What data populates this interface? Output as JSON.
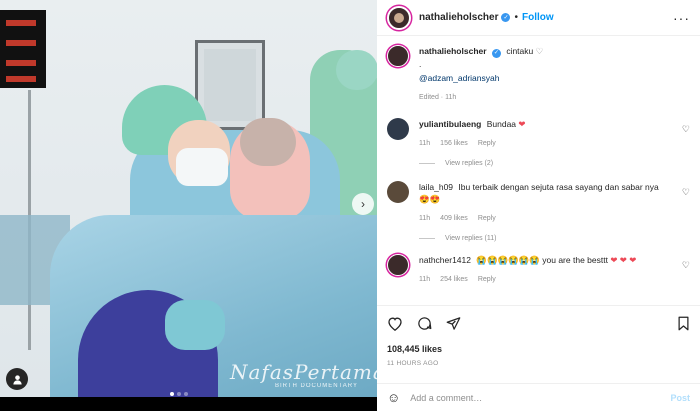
{
  "post": {
    "watermark": "NafasPertama",
    "watermark_sub": "BIRTH DOCUMENTARY"
  },
  "header": {
    "username": "nathalieholscher",
    "follow_label": "Follow",
    "dot": "•"
  },
  "caption": {
    "username": "nathalieholscher",
    "text": "cintaku",
    "heart": "♡",
    "dot_line": ".",
    "mention": "@adzam_adriansyah",
    "meta": "Edited · 11h"
  },
  "comments": [
    {
      "username": "yuliantibulaeng",
      "text": "Bundaa",
      "emoji": "❤",
      "time": "11h",
      "likes": "156 likes",
      "reply": "Reply",
      "view_replies": "View replies (2)"
    },
    {
      "username": "laila_h09",
      "text": "Ibu terbaik dengan sejuta rasa sayang dan sabar nya",
      "emoji": "😍😍",
      "time": "11h",
      "likes": "409 likes",
      "reply": "Reply",
      "view_replies": "View replies (11)"
    },
    {
      "username": "nathcher1412",
      "text": "you are the besttt",
      "emoji_prefix": "😭😭😭😭😭😭",
      "emoji": "❤ ❤ ❤",
      "time": "11h",
      "likes": "254 likes",
      "reply": "Reply"
    }
  ],
  "actions": {
    "likes": "108,445 likes",
    "time": "11 HOURS AGO"
  },
  "add_comment": {
    "placeholder": "Add a comment…",
    "post_label": "Post"
  },
  "colors": {
    "accent": "#0095f6",
    "verified": "#3897f0",
    "heart_red": "#ed4956"
  }
}
